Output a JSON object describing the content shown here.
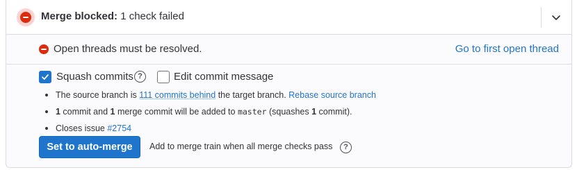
{
  "header": {
    "title_bold": "Merge blocked:",
    "title_rest": " 1 check failed"
  },
  "blocker": {
    "text": "Open threads must be resolved.",
    "link": "Go to first open thread"
  },
  "options": {
    "squash_label": "Squash commits",
    "squash_checked": true,
    "edit_label": "Edit commit message",
    "edit_checked": false,
    "help_glyph": "?"
  },
  "info": {
    "line1_pre": "The source branch is ",
    "line1_link": "111 commits behind",
    "line1_mid": " the target branch. ",
    "line1_link2": "Rebase source branch",
    "line2_count1": "1",
    "line2_a": " commit and ",
    "line2_count2": "1",
    "line2_b": " merge commit will be added to ",
    "line2_branch": "master",
    "line2_c": " (squashes ",
    "line2_count3": "1",
    "line2_d": " commit).",
    "line3_pre": "Closes issue ",
    "line3_link": "#2754"
  },
  "action": {
    "button_label": "Set to auto-merge",
    "train_text": "Add to merge train when all merge checks pass"
  },
  "colors": {
    "accent": "#1f75cb",
    "danger": "#dd2b0e"
  },
  "icons": [
    "merge-blocked-icon",
    "chevron-down-icon",
    "error-icon",
    "check-icon",
    "question-circle-icon"
  ]
}
